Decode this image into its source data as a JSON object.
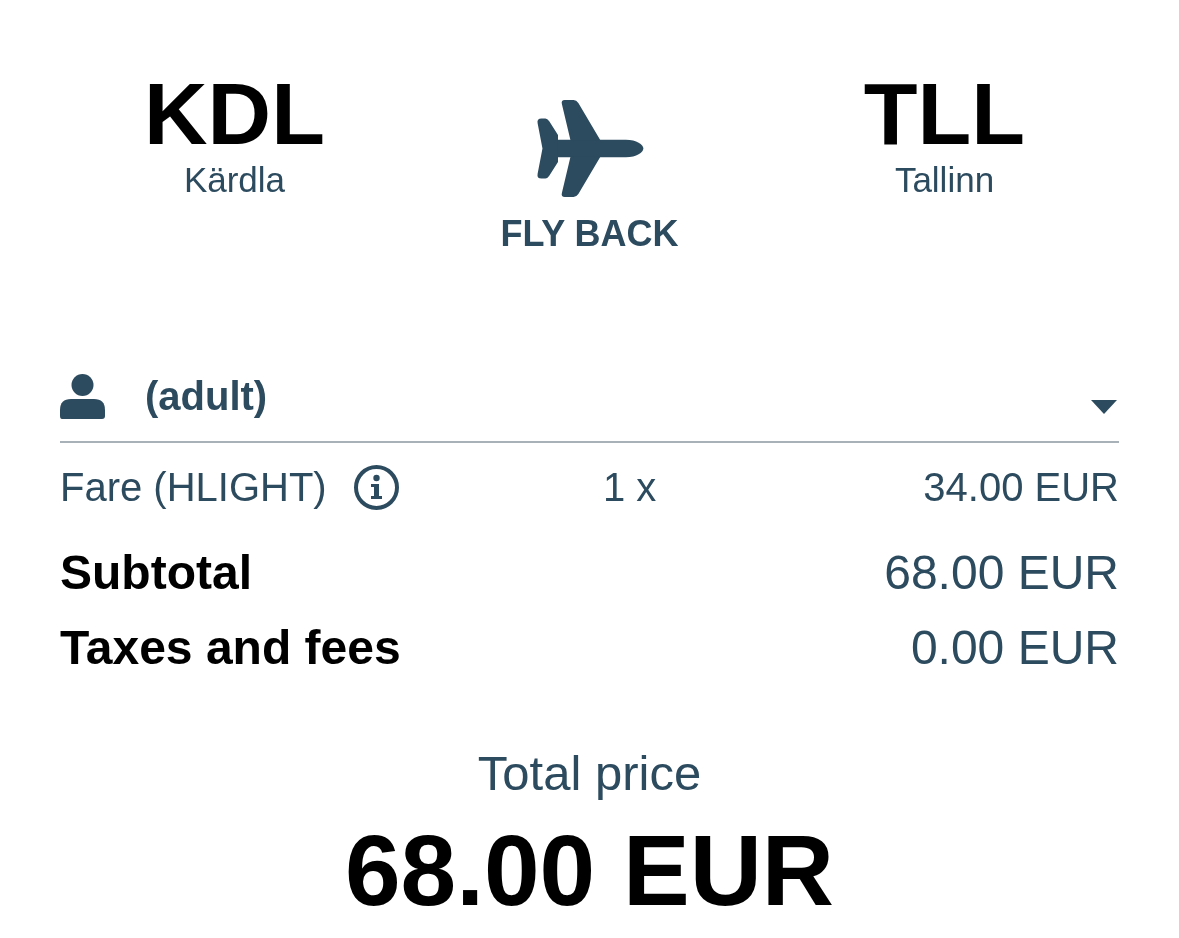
{
  "route": {
    "origin": {
      "code": "KDL",
      "city": "Kärdla"
    },
    "destination": {
      "code": "TLL",
      "city": "Tallinn"
    },
    "direction": "FLY BACK"
  },
  "passenger": {
    "label": "(adult)",
    "expanded": false
  },
  "fare_lines": [
    {
      "label": "Fare (HLIGHT)",
      "quantity": "1 x",
      "amount": "34.00 EUR"
    }
  ],
  "summary": [
    {
      "label": "Subtotal",
      "amount": "68.00 EUR"
    },
    {
      "label": "Taxes and fees",
      "amount": "0.00 EUR"
    }
  ],
  "total": {
    "label": "Total price",
    "amount": "68.00 EUR"
  }
}
